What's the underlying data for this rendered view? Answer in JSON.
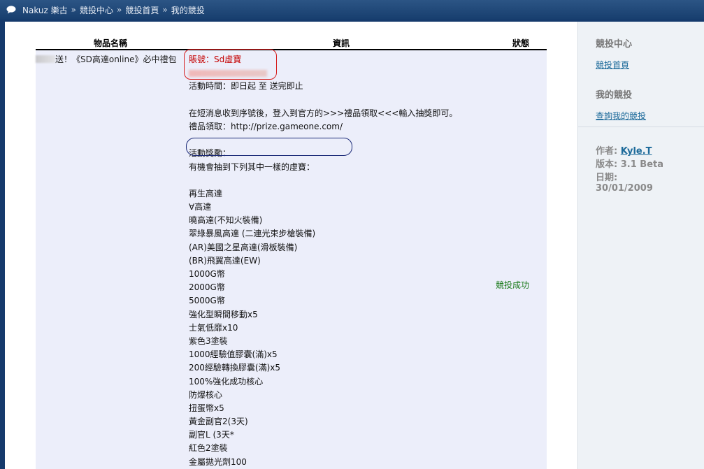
{
  "breadcrumb": {
    "items": [
      "Nakuz 樂古",
      "競投中心",
      "競投首頁",
      "我的競投"
    ],
    "separator": "»"
  },
  "table": {
    "headers": {
      "name": "物品名稱",
      "info": "資訊",
      "status": "狀態"
    },
    "row": {
      "name": "送！《SD高達online》必中禮包",
      "account_label": "賬號：Sd虛寶",
      "info_lines": [
        "活動時間：即日起 至 送完即止",
        "",
        "在短消息收到序號後，登入到官方的>>>禮品領取<<<輸入抽獎即可。",
        "禮品領取：http://prize.gameone.com/",
        "",
        "活動獎勵：",
        "有機會抽到下列其中一樣的虛寶：",
        "",
        "再生高達",
        "∀高達",
        "曉高達(不知火裝備)",
        "翠綠暴風高達 (二連光束步槍裝備)",
        "(AR)美國之星高達(滑板裝備)",
        "(BR)飛翼高達(EW)",
        "1000G幣",
        "2000G幣",
        "5000G幣",
        "強化型瞬間移動x5",
        "士氣低靡x10",
        "紫色3塗裝",
        "1000經驗值膠囊(滿)x5",
        "200經驗轉換膠囊(滿)x5",
        "100%強化成功核心",
        "防爆核心",
        "扭蛋幣x5",
        "黃金副官2(3天)",
        "副官L (3天*",
        "紅色2塗裝",
        "金屬拋光劑100"
      ],
      "status": "競投成功"
    }
  },
  "sidebar": {
    "center_title": "競投中心",
    "home_link": "競投首頁",
    "my_title": "我的競投",
    "query_link": "查詢我的競投",
    "author_label": "作者:",
    "author_value": "Kyle.T",
    "version_label": "版本:",
    "version_value": "3.1 Beta",
    "date_label": "日期:",
    "date_value": "30/01/2009"
  }
}
